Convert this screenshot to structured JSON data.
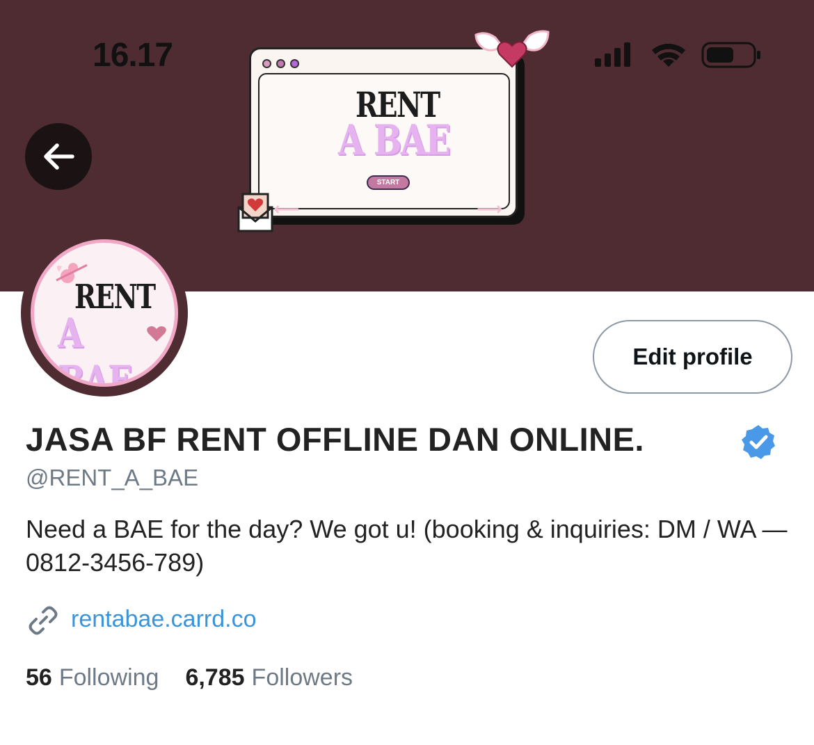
{
  "status_bar": {
    "time": "16.17"
  },
  "art": {
    "logo_line1": "RENT",
    "logo_line2": "A BAE",
    "start_label": "START"
  },
  "avatar": {
    "logo_line1": "RENT",
    "logo_line2": "A BAE"
  },
  "profile": {
    "edit_label": "Edit profile",
    "name": "JASA BF RENT OFFLINE DAN ONLINE.",
    "handle": "@RENT_A_BAE",
    "bio": "Need a BAE for the day? We got u! (booking & inquiries: DM / WA — 0812-3456-789)",
    "link": "rentabae.carrd.co",
    "following_count": "56",
    "following_label": "Following",
    "followers_count": "6,785",
    "followers_label": "Followers"
  },
  "colors": {
    "banner": "#4f2c31",
    "accent_link": "#3b94d9",
    "verified": "#4a99e9"
  },
  "icons": [
    "back-arrow-icon",
    "signal-icon",
    "wifi-icon",
    "battery-icon",
    "verified-badge-icon",
    "link-icon",
    "heart-wings-icon",
    "love-letter-icon",
    "cupid-icon"
  ]
}
